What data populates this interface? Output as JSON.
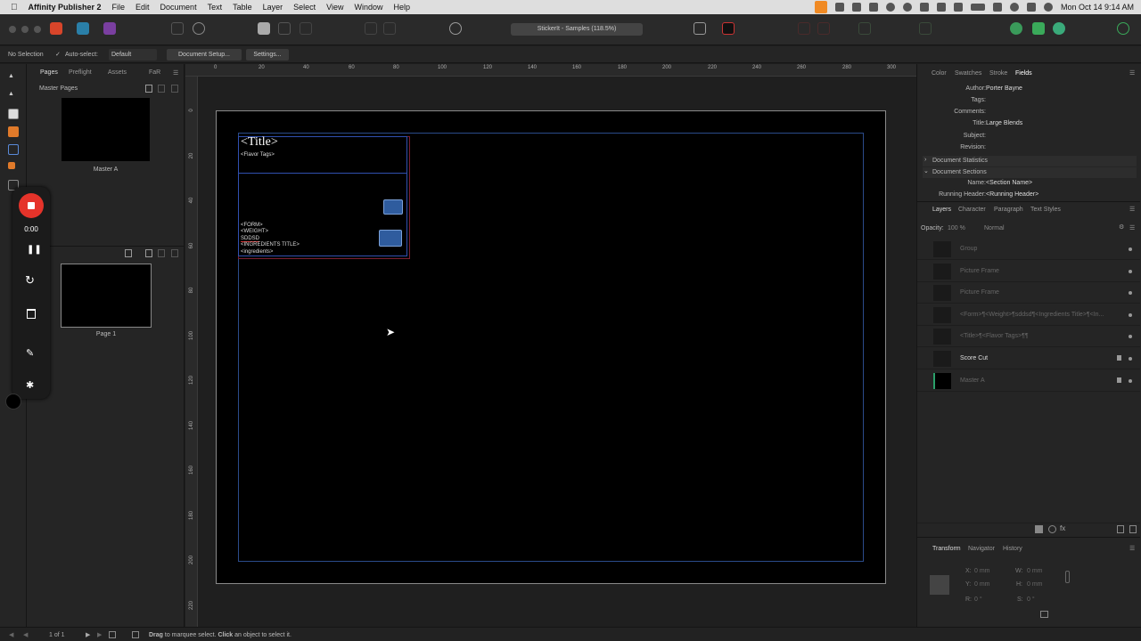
{
  "menubar": {
    "app_name": "Affinity Publisher 2",
    "items": [
      "File",
      "Edit",
      "Document",
      "Text",
      "Table",
      "Layer",
      "Select",
      "View",
      "Window",
      "Help"
    ],
    "clock": "Mon Oct 14  9:14 AM"
  },
  "toolbar": {
    "doc_title": "StickerIt - Samples (118.5%)"
  },
  "context": {
    "selection": "No Selection",
    "autoselect_label": "Auto-select:",
    "autoselect_value": "Default",
    "doc_setup": "Document Setup...",
    "settings": "Settings..."
  },
  "left_panel": {
    "tabs": [
      "Pages",
      "Preflight",
      "Assets",
      "FaR"
    ],
    "master_section": "Master Pages",
    "master_name": "Master A",
    "page_name": "Page 1"
  },
  "recorder": {
    "time": "0:00"
  },
  "rulers": {
    "h": [
      "0",
      "20",
      "40",
      "60",
      "80",
      "100",
      "120",
      "140",
      "160",
      "180",
      "200",
      "220",
      "240",
      "260",
      "280",
      "300"
    ],
    "v": [
      "0",
      "20",
      "40",
      "60",
      "80",
      "100",
      "120",
      "140",
      "160",
      "180",
      "200",
      "220"
    ]
  },
  "canvas": {
    "title_text": "<Title>",
    "flavor_tags": "<Flavor Tags>",
    "form": "<FORM>",
    "weight": "<WEIGHT>",
    "sddsd": "SDDSD",
    "ingredients_title": "<INGREDIENTS TITLE>",
    "ingredients": "<ingredients>"
  },
  "right_panel": {
    "tabs": [
      "Color",
      "Swatches",
      "Stroke",
      "Fields"
    ],
    "fields": [
      {
        "label": "Author:",
        "value": "Porter Bayne"
      },
      {
        "label": "Tags:",
        "value": ""
      },
      {
        "label": "Comments:",
        "value": ""
      },
      {
        "label": "Title:",
        "value": "Large Blends"
      },
      {
        "label": "Subject:",
        "value": ""
      },
      {
        "label": "Revision:",
        "value": ""
      }
    ],
    "doc_stats": "Document Statistics",
    "doc_sections": "Document Sections",
    "section_name_label": "Name:",
    "section_name_value": "<Section Name>",
    "running_header_label": "Running Header:",
    "running_header_value": "<Running Header>",
    "layer_tabs": [
      "Layers",
      "Character",
      "Paragraph",
      "Text Styles"
    ],
    "opacity_label": "Opacity:",
    "opacity_value": "100 %",
    "blend_mode": "Normal",
    "layers": [
      {
        "name": "Group",
        "dim": true
      },
      {
        "name": "Picture Frame",
        "dim": true
      },
      {
        "name": "Picture Frame",
        "dim": true
      },
      {
        "name": "<Form>¶<Weight>¶sddsd¶<Ingredients Title>¶<In...",
        "dim": true
      },
      {
        "name": "<Title>¶<Flavor Tags>¶¶",
        "dim": true
      },
      {
        "name": "Score Cut",
        "dim": false
      },
      {
        "name": "Master A",
        "dim": true
      }
    ],
    "bottom_tabs": [
      "Transform",
      "Navigator",
      "History"
    ],
    "transform": {
      "x_label": "X:",
      "x_value": "0 mm",
      "y_label": "Y:",
      "y_value": "0 mm",
      "w_label": "W:",
      "w_value": "0 mm",
      "h_label": "H:",
      "h_value": "0 mm",
      "r_label": "R:",
      "r_value": "0 °",
      "s_label": "S:",
      "s_value": "0 °"
    }
  },
  "statusbar": {
    "page_count": "1 of 1",
    "drag": "Drag",
    "hint1": " to marquee select. ",
    "click": "Click",
    "hint2": " an object to select it."
  },
  "colors": {
    "accent_blue": "#2b4b8a",
    "record_red": "#e5332a",
    "frame_red": "#7a2030"
  }
}
